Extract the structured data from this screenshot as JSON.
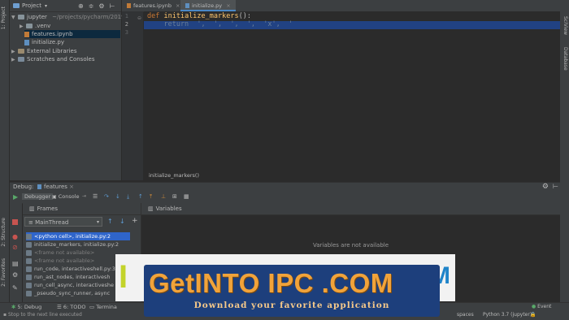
{
  "left_stripe": {
    "tabs": [
      "1: Project",
      "2: Structure",
      "2: Favorites"
    ]
  },
  "right_stripe": {
    "tabs": [
      "SciView",
      "Database"
    ]
  },
  "project": {
    "header": "Project",
    "tree": [
      {
        "label": "jupyter",
        "path": "~/projects/pycharm/2019..."
      },
      {
        "label": ".venv"
      },
      {
        "label": "features.ipynb"
      },
      {
        "label": "initialize.py"
      },
      {
        "label": "External Libraries"
      },
      {
        "label": "Scratches and Consoles"
      }
    ]
  },
  "editor": {
    "tabs": [
      "features.ipynb",
      "initialize.py"
    ],
    "line_numbers": [
      "1",
      "2",
      "3"
    ],
    "line1": {
      "kw": "def",
      "fn": "initialize_markers",
      "rest": "():"
    },
    "line2": "    return  ',  ',  ',  ',  'x',  '",
    "breadcrumb": "initialize_markers()"
  },
  "debug": {
    "label": "Debug:",
    "config": "features",
    "tabs": {
      "debugger": "Debugger",
      "console": "Console"
    },
    "frames_title": "Frames",
    "variables_title": "Variables",
    "thread": "MainThread",
    "variables_empty": "Variables are not available",
    "frames": [
      "<python cell>, initialize.py:2",
      "initialize_markers, initialize.py:2",
      "<frame not available>",
      "<frame not available>",
      "run_code, interactiveshell.py:3",
      "run_ast_nodes, interactivesh",
      "run_cell_async, interactiveshe",
      "_pseudo_sync_runner, async"
    ]
  },
  "status_bar": {
    "tabs": {
      "debug": "5: Debug",
      "todo": "6: TODO",
      "terminal": "Termina"
    },
    "message": "Stop to the next line executed",
    "indent": "spaces",
    "interpreter": "Python 3.7 (jupyter)",
    "event_log": "Event"
  },
  "watermark": {
    "brand": "GetINTO IPC .COM",
    "tagline": "Download your favorite application"
  },
  "colors": {
    "accent": "#2f65ca",
    "selection": "#214283",
    "keyword": "#cc7832",
    "function": "#ffc66d",
    "string": "#6a8759"
  }
}
